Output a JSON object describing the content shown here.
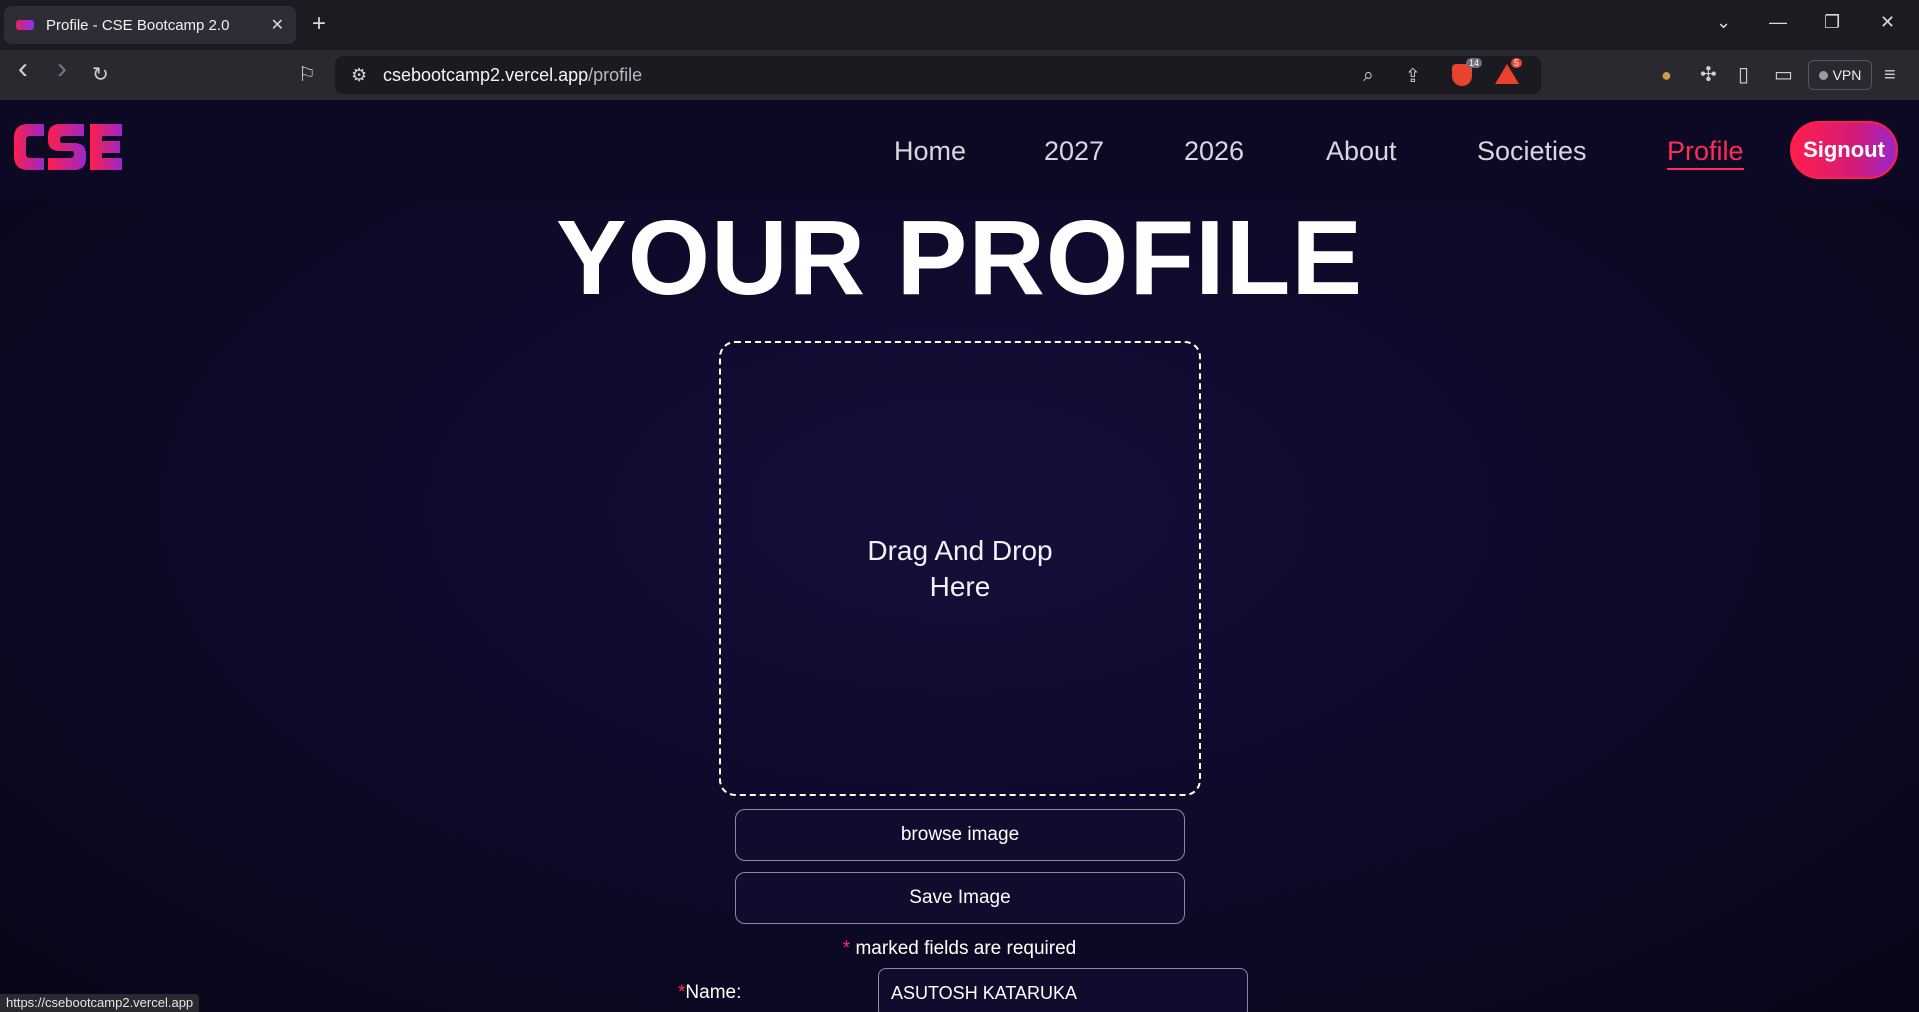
{
  "browser": {
    "tab_title": "Profile - CSE Bootcamp 2.0",
    "tab_close": "✕",
    "new_tab": "+",
    "url_host": "csebootcamp2.vercel.app",
    "url_path": "/profile",
    "shield_count": "14",
    "alert_count": "5",
    "vpn_label": "VPN",
    "status_url": "https://csebootcamp2.vercel.app",
    "icons": {
      "tab_list": "⌄",
      "minimize": "—",
      "restore": "❐",
      "close": "✕",
      "back": "‹",
      "forward": "›",
      "reload": "↻",
      "bookmark": "⚐",
      "site_info": "⚙",
      "zoom": "⌕",
      "share": "⇪",
      "rewards": "●",
      "extensions": "✣",
      "sidebar": "▯",
      "wallet": "▭",
      "menu": "≡"
    }
  },
  "nav": {
    "items": [
      "Home",
      "2027",
      "2026",
      "About",
      "Societies",
      "Profile"
    ],
    "active": "Profile",
    "signout_label": "Signout"
  },
  "profile": {
    "heading": "YOUR PROFILE",
    "dropzone_text": "Drag And Drop Here",
    "browse_label": "browse image",
    "save_label": "Save Image",
    "required_star": "*",
    "required_note": " marked fields are required",
    "name_label": "Name:",
    "name_value": "ASUTOSH KATARUKA"
  },
  "colors": {
    "accent": "#ff2d55",
    "page_bg": "#0e0a2a",
    "logo_gradient": [
      "#ff1f4b",
      "#9b27c9"
    ]
  }
}
